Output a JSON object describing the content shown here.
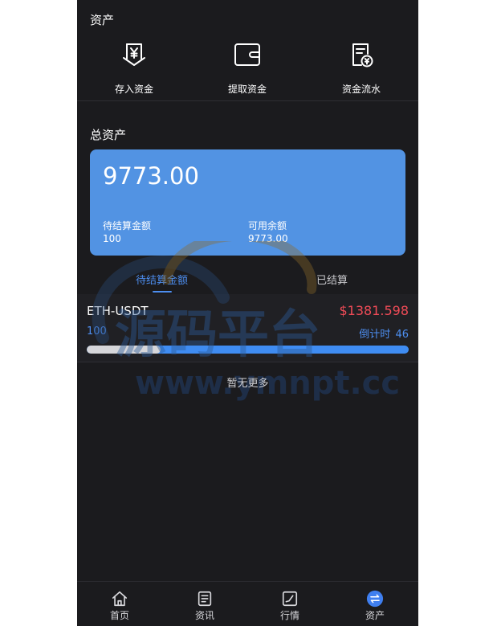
{
  "header": {
    "title": "资产"
  },
  "actions": [
    {
      "label": "存入资金",
      "icon": "deposit-yen-icon"
    },
    {
      "label": "提取资金",
      "icon": "wallet-icon"
    },
    {
      "label": "资金流水",
      "icon": "statement-yen-icon"
    }
  ],
  "summary": {
    "title": "总资产",
    "total": "9773.00",
    "pending_label": "待结算金额",
    "pending_value": "100",
    "available_label": "可用余额",
    "available_value": "9773.00",
    "card_color": "#5293e3"
  },
  "tabs": [
    {
      "label": "待结算金额",
      "active": true
    },
    {
      "label": "已结算",
      "active": false
    }
  ],
  "orders": [
    {
      "pair": "ETH-USDT",
      "price": "$1381.598",
      "amount": "100",
      "countdown_label": "倒计时",
      "countdown_value": "46",
      "progress": 0.23
    }
  ],
  "list_footer": "暂无更多",
  "watermark": {
    "text": "源码平台",
    "url": "www.ymnpt.cc"
  },
  "tabbar": [
    {
      "label": "首页",
      "icon": "home-icon",
      "active": false
    },
    {
      "label": "资讯",
      "icon": "news-icon",
      "active": false
    },
    {
      "label": "行情",
      "icon": "market-chart-icon",
      "active": false
    },
    {
      "label": "资产",
      "icon": "assets-exchange-icon",
      "active": true
    }
  ],
  "colors": {
    "accent": "#4d8ef0",
    "price_up": "#ef4b57",
    "background": "#1b1b1e"
  }
}
